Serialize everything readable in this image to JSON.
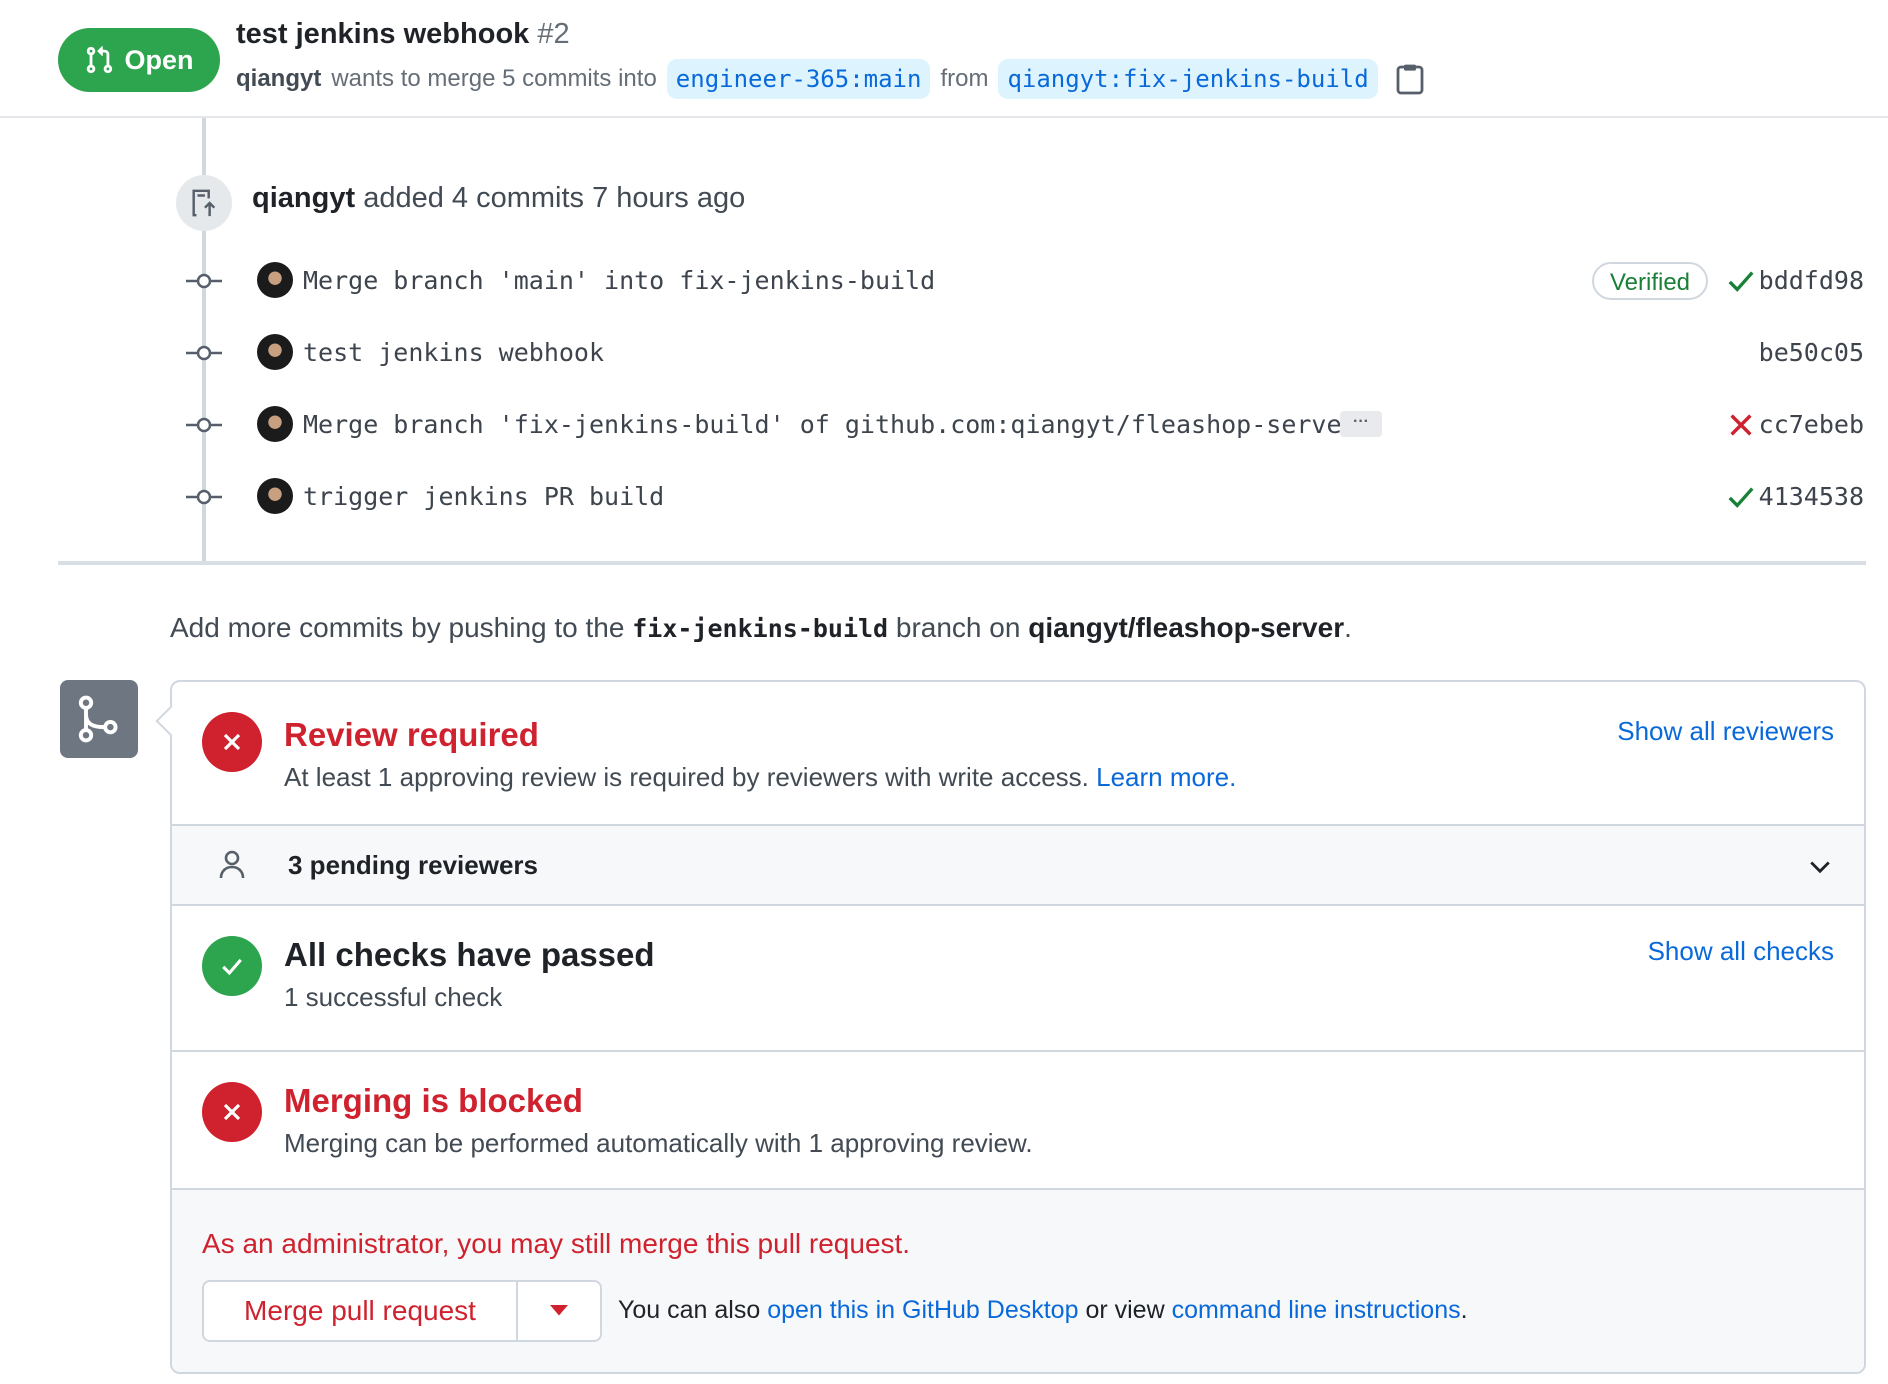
{
  "header": {
    "state": "Open",
    "title": "test jenkins webhook",
    "number": "#2",
    "author": "qiangyt",
    "merge_text": "wants to merge 5 commits into",
    "base_branch": "engineer-365:main",
    "from_text": "from",
    "head_branch": "qiangyt:fix-jenkins-build"
  },
  "push_event": {
    "author": "qiangyt",
    "text": "added 4 commits 7 hours ago"
  },
  "commits": [
    {
      "message": "Merge branch 'main' into fix-jenkins-build",
      "sha": "bddfd98",
      "verified": "Verified",
      "status": "success"
    },
    {
      "message": "test jenkins webhook",
      "sha": "be50c05",
      "status": "none"
    },
    {
      "message": "Merge branch 'fix-jenkins-build' of github.com:qiangyt/fleashop-serve…",
      "sha": "cc7ebeb",
      "status": "failure",
      "more": "···"
    },
    {
      "message": "trigger jenkins PR build",
      "sha": "4134538",
      "status": "success"
    }
  ],
  "hint": {
    "prefix": "Add more commits by pushing to the",
    "branch": "fix-jenkins-build",
    "middle": "branch on",
    "repo": "qiangyt/fleashop-server",
    "suffix": "."
  },
  "review": {
    "title": "Review required",
    "subtitle": "At least 1 approving review is required by reviewers with write access.",
    "learn_more": "Learn more.",
    "link": "Show all reviewers"
  },
  "reviewers": {
    "label": "3 pending reviewers"
  },
  "checks": {
    "title": "All checks have passed",
    "subtitle": "1 successful check",
    "link": "Show all checks"
  },
  "blocked": {
    "title": "Merging is blocked",
    "subtitle": "Merging can be performed automatically with 1 approving review."
  },
  "admin": {
    "notice": "As an administrator, you may still merge this pull request.",
    "merge_button": "Merge pull request",
    "alt_prefix": "You can also",
    "desktop_link": "open this in GitHub Desktop",
    "alt_middle": "or view",
    "cli_link": "command line instructions",
    "alt_suffix": "."
  },
  "colors": {
    "open_green": "#2da44e",
    "danger_red": "#cf222e",
    "link_blue": "#0969da",
    "verified_green": "#1a7f37"
  },
  "icons": [
    "git-pull-request-icon",
    "copy-icon",
    "repo-push-icon",
    "git-commit-icon",
    "check-icon",
    "x-icon",
    "git-merge-icon",
    "person-icon",
    "chevron-down-icon",
    "triangle-down-icon"
  ]
}
